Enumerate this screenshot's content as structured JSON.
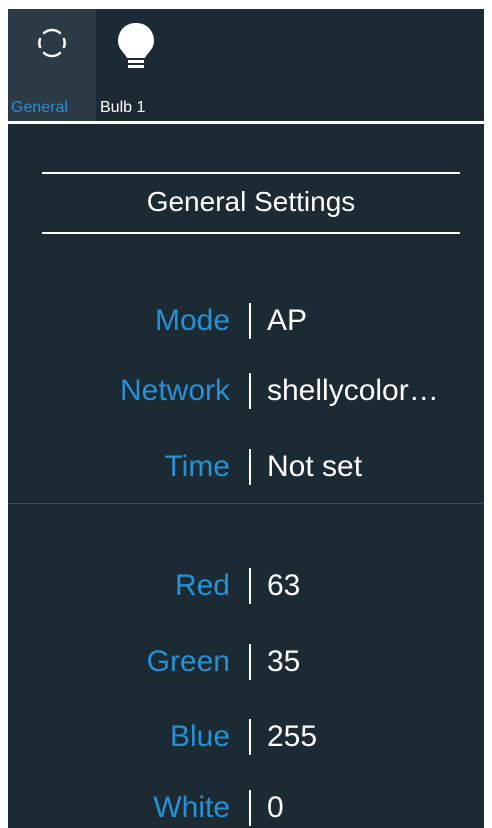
{
  "tabs": [
    {
      "label": "General",
      "icon": "focus-frame-icon"
    },
    {
      "label": "Bulb 1",
      "icon": "lightbulb-icon"
    }
  ],
  "section": {
    "title": "General Settings"
  },
  "info_rows": [
    {
      "label": "Mode",
      "value": "AP"
    },
    {
      "label": "Network",
      "value": "shellycolor…"
    },
    {
      "label": "Time",
      "value": "Not set"
    }
  ],
  "color_rows": [
    {
      "label": "Red",
      "value": "63"
    },
    {
      "label": "Green",
      "value": "35"
    },
    {
      "label": "Blue",
      "value": "255"
    },
    {
      "label": "White",
      "value": "0"
    }
  ],
  "colors": {
    "background": "#1b2a33",
    "accent": "#2591d6",
    "active_tab": "#2b3a44",
    "text": "#ffffff"
  }
}
